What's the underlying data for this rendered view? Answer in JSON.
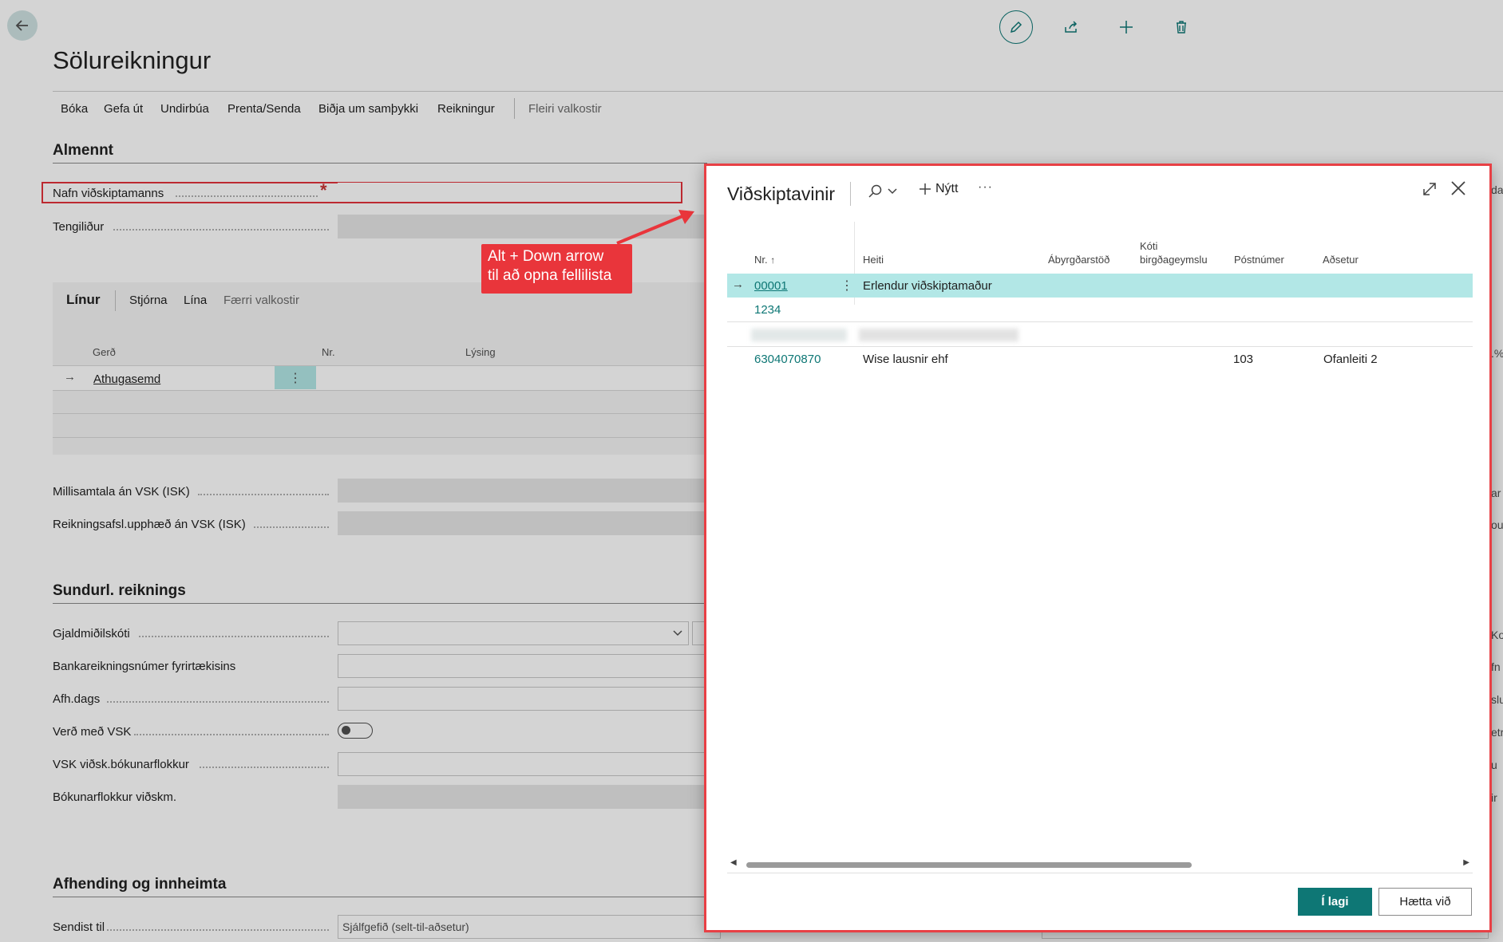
{
  "page": {
    "title": "Sölureikningur",
    "actions": [
      "Bóka",
      "Gefa út",
      "Undirbúa",
      "Prenta/Senda",
      "Biðja um samþykki",
      "Reikningur",
      "Fleiri valkostir"
    ]
  },
  "sections": {
    "general": "Almennt",
    "lines": "Línur",
    "invoice_details": "Sundurl. reiknings",
    "shipping": "Afhending og innheimta"
  },
  "fields": {
    "customer_name": "Nafn viðskiptamanns",
    "contact": "Tengiliður",
    "subtotal": "Millisamtala án VSK (ISK)",
    "invoice_discount": "Reikningsafsl.upphæð án VSK (ISK)",
    "currency_code": "Gjaldmiðilskóti",
    "bank_account": "Bankareikningsnúmer fyrirtækisins",
    "delivery_date": "Afh.dags",
    "price_incl_vat": "Verð með VSK",
    "vat_bus_posting_group": "VSK viðsk.bókunarflokkur",
    "customer_posting_group": "Bókunarflokkur viðskm.",
    "ship_to": "Sendist til",
    "ship_to_value": "Sjálfgefið (selt-til-aðsetur)"
  },
  "lines": {
    "toolbar": [
      "Stjórna",
      "Lína",
      "Færri valkostir"
    ],
    "columns": [
      "Gerð",
      "Nr.",
      "Lýsing"
    ],
    "first_row_type": "Athugasemd"
  },
  "callout": {
    "line1": "Alt + Down arrow",
    "line2": "til að opna fellilista"
  },
  "dialog": {
    "title": "Viðskiptavinir",
    "new_label": "Nýtt",
    "more": "···",
    "columns": {
      "no": "Nr.",
      "name": "Heiti",
      "responsibility_center": "Ábyrgðarstöð",
      "location_code_l1": "Kóti",
      "location_code_l2": "birgðageymslu",
      "post_code": "Póstnúmer",
      "address": "Aðsetur"
    },
    "rows": [
      {
        "no": "00001",
        "name": "Erlendur viðskiptamaður",
        "post_code": "",
        "address": ""
      },
      {
        "no": "1234",
        "name": "",
        "post_code": "",
        "address": ""
      },
      {
        "no": "",
        "name": "",
        "post_code": "",
        "address": ""
      },
      {
        "no": "6304070870",
        "name": "Wise lausnir ehf",
        "post_code": "103",
        "address": "Ofanleiti 2"
      }
    ],
    "ok_label": "Í lagi",
    "cancel_label": "Hætta við"
  },
  "colors": {
    "accent": "#0e7775",
    "highlight_row": "#b2e7e6",
    "callout": "#e9353b",
    "required": "#c83434"
  }
}
